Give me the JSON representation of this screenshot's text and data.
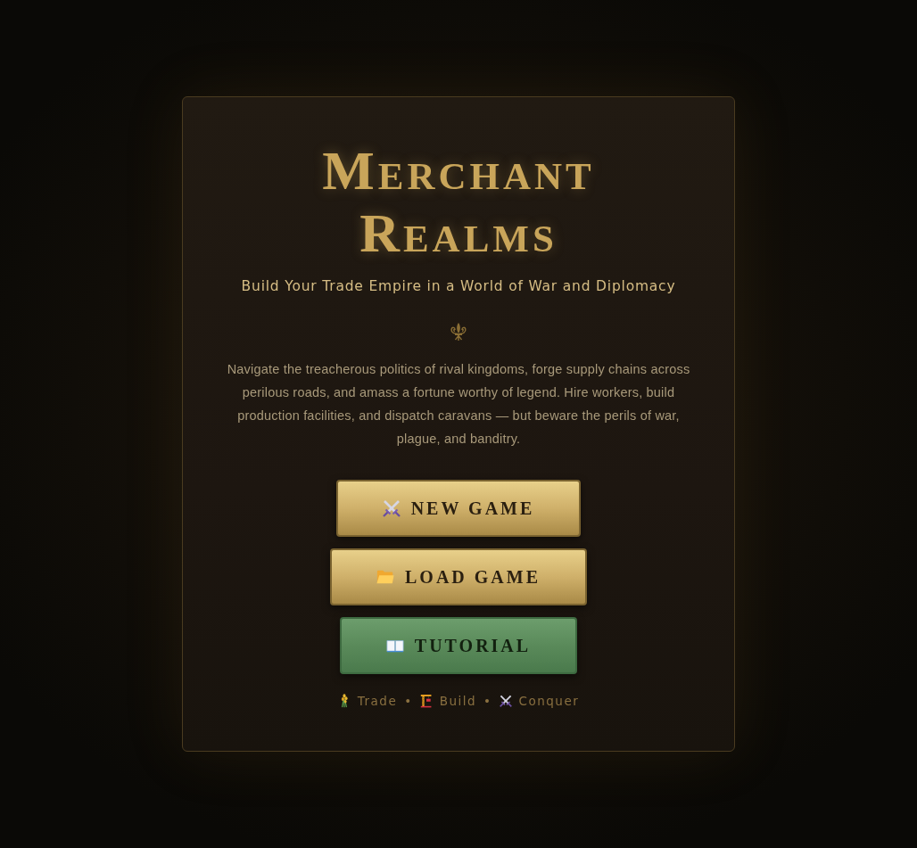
{
  "title": "Merchant Realms",
  "subtitle": "Build Your Trade Empire in a World of War and Diplomacy",
  "description": "Navigate the treacherous politics of rival kingdoms, forge supply chains across perilous roads, and amass a fortune worthy of legend. Hire workers, build production facilities, and dispatch caravans — but beware the perils of war, plague, and banditry.",
  "buttons": [
    {
      "label": "NEW GAME",
      "kind": "primary"
    },
    {
      "label": "LOAD GAME",
      "kind": "primary"
    },
    {
      "label": "TUTORIAL",
      "kind": "secondary"
    }
  ],
  "tagline": [
    {
      "kind": "item",
      "label": "Trade"
    },
    {
      "kind": "separator",
      "label": "•"
    },
    {
      "kind": "item",
      "label": "Build"
    },
    {
      "kind": "separator",
      "label": "•"
    },
    {
      "kind": "item",
      "label": "Conquer"
    }
  ]
}
